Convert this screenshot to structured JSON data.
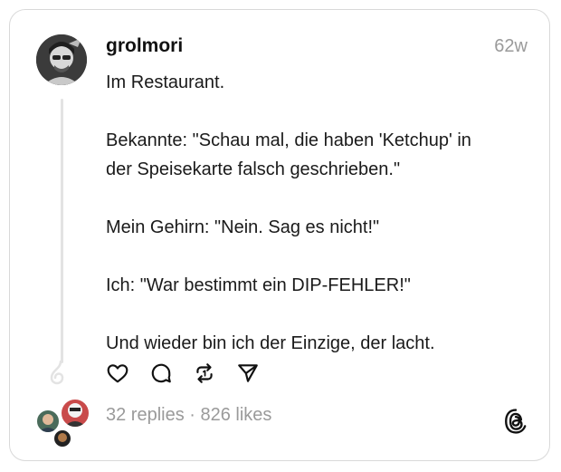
{
  "post": {
    "username": "grolmori",
    "time": "62w",
    "lines": [
      "Im Restaurant.",
      "",
      "Bekannte: \"Schau mal, die haben 'Ketchup' in",
      "der Speisekarte falsch geschrieben.\"",
      "",
      "Mein Gehirn: \"Nein. Sag es nicht!\"",
      "",
      "Ich: \"War bestimmt ein DIP-FEHLER!\"",
      "",
      "Und wieder bin ich der Einzige, der lacht."
    ],
    "stats": "32 replies · 826 likes"
  },
  "icons": {
    "like": "heart-icon",
    "reply": "comment-icon",
    "repost": "repost-icon",
    "share": "send-icon",
    "brand": "threads-logo-icon"
  },
  "colors": {
    "text": "#1a1a1a",
    "muted": "#9a9a9a",
    "border": "#d9d9d9"
  }
}
